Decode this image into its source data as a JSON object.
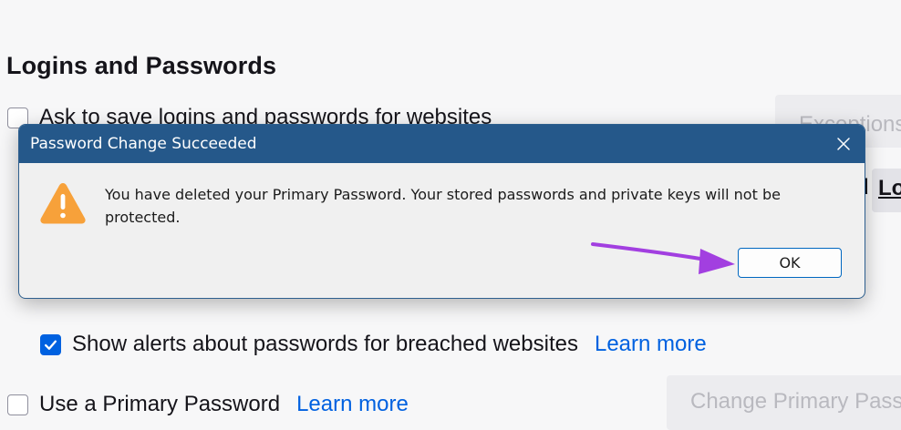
{
  "settings": {
    "section_title": "Logins and Passwords",
    "ask_save_label": "Ask to save logins and passwords for websites",
    "ask_save_checked": false,
    "exceptions_label": "Exceptions",
    "partial_label_fragment": "d",
    "partial_button_fragment": "Lo",
    "breach_alerts_label": "Show alerts about passwords for breached websites",
    "breach_alerts_checked": true,
    "breach_learn_more": "Learn more",
    "primary_password_label": "Use a Primary Password",
    "primary_password_checked": false,
    "primary_learn_more": "Learn more",
    "change_primary_label": "Change Primary Password..."
  },
  "dialog": {
    "title": "Password Change Succeeded",
    "message": "You have deleted your Primary Password. Your stored passwords and private keys will not be protected.",
    "ok_label": "OK",
    "icon": "warning-icon"
  },
  "colors": {
    "accent": "#0061e0",
    "titlebar": "#25588a",
    "warning": "#f7a13a",
    "annotation_arrow": "#a23fe0"
  }
}
